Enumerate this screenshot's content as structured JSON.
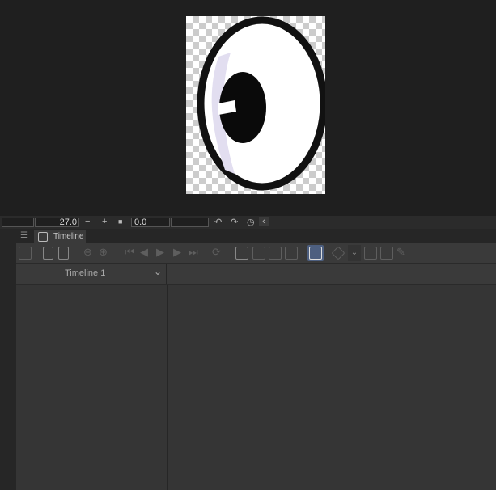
{
  "playback": {
    "frame_value": "27.0",
    "time_value": "0.0",
    "minus": "−",
    "plus": "+",
    "stop": "■",
    "undo": "↶",
    "redo": "↷",
    "collapse": "‹"
  },
  "panel": {
    "menu_icon": "☰",
    "tab_label": "Timeline"
  },
  "timeline": {
    "selected": "Timeline 1"
  },
  "colors": {
    "accent": "#4d5f80",
    "panel": "#3a3a3a",
    "background": "#1f1f1f"
  }
}
